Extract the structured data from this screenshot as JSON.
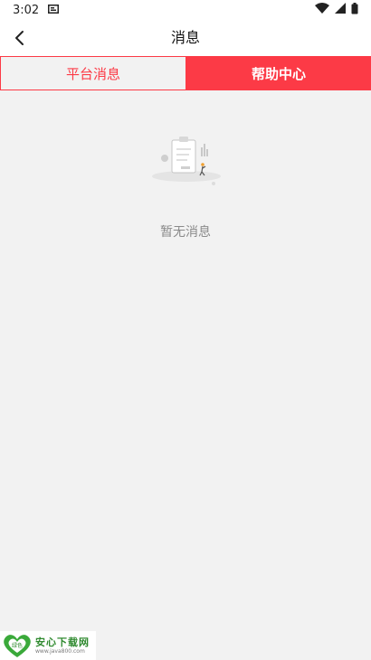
{
  "status_bar": {
    "time": "3:02"
  },
  "app_bar": {
    "title": "消息"
  },
  "tabs": [
    {
      "label": "平台消息",
      "active": false
    },
    {
      "label": "帮助中心",
      "active": true
    }
  ],
  "empty_state": {
    "text": "暂无消息"
  },
  "watermark": {
    "title": "安心下载网",
    "url": "www.java800.com",
    "badge_text": "绿色"
  },
  "colors": {
    "accent": "#fc3a46",
    "background": "#f2f2f2",
    "empty_text": "#8a8a8a"
  }
}
